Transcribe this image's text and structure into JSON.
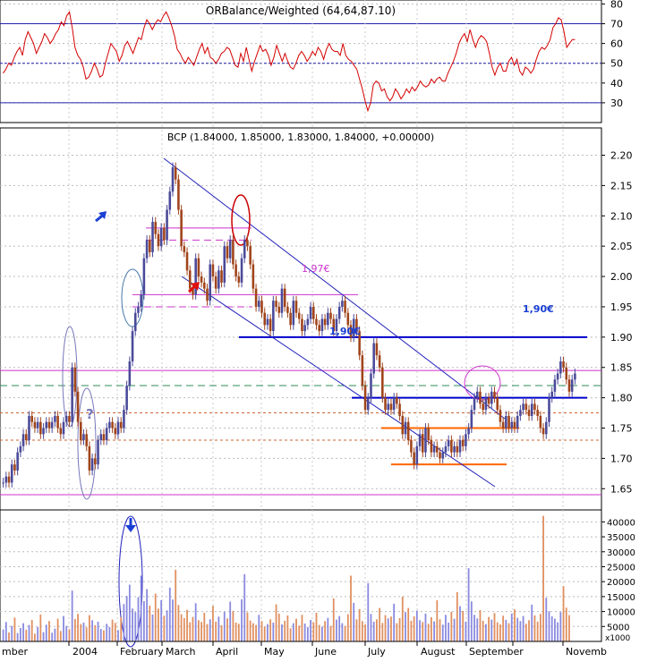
{
  "chart_data": {
    "type": "candlestick",
    "panels": [
      {
        "id": "rsi",
        "title": "ORBalance/Weighted (64,64,87.10)",
        "ylim": [
          20,
          82
        ],
        "tick_labels": [
          "80",
          "70",
          "60",
          "50",
          "40",
          "30"
        ],
        "reference_lines": [
          70,
          50,
          30
        ],
        "series_color": "#d40000",
        "values": [
          45,
          47,
          50,
          49,
          53,
          56,
          58,
          54,
          62,
          66,
          63,
          60,
          55,
          58,
          61,
          65,
          63,
          60,
          62,
          65,
          67,
          71,
          69,
          74,
          76,
          68,
          58,
          54,
          52,
          48,
          42,
          43,
          46,
          50,
          47,
          43,
          44,
          50,
          55,
          60,
          58,
          56,
          51,
          54,
          59,
          61,
          58,
          55,
          59,
          63,
          62,
          68,
          72,
          70,
          67,
          70,
          72,
          71,
          74,
          76,
          73,
          69,
          64,
          57,
          55,
          52,
          50,
          53,
          51,
          49,
          53,
          57,
          60,
          55,
          58,
          53,
          52,
          50,
          52,
          55,
          56,
          58,
          57,
          53,
          49,
          48,
          55,
          51,
          58,
          52,
          46,
          51,
          55,
          59,
          56,
          57,
          54,
          49,
          53,
          59,
          55,
          51,
          55,
          51,
          48,
          47,
          50,
          54,
          56,
          54,
          51,
          53,
          56,
          54,
          58,
          56,
          52,
          57,
          60,
          57,
          56,
          56,
          54,
          60,
          54,
          52,
          51,
          49,
          47,
          42,
          37,
          31,
          26,
          30,
          39,
          41,
          40,
          36,
          37,
          33,
          31,
          33,
          37,
          35,
          32,
          34,
          37,
          35,
          38,
          36,
          38,
          41,
          39,
          38,
          39,
          42,
          40,
          42,
          43,
          41,
          41,
          45,
          48,
          51,
          55,
          60,
          63,
          65,
          61,
          67,
          62,
          58,
          62,
          64,
          63,
          61,
          55,
          48,
          44,
          48,
          50,
          46,
          46,
          51,
          53,
          49,
          52,
          46,
          44,
          48,
          47,
          45,
          47,
          52,
          56,
          58,
          57,
          59,
          62,
          68,
          70,
          73,
          72,
          66,
          58,
          60,
          62,
          62
        ]
      },
      {
        "id": "price",
        "title": "BCP (1.84000, 1.85000, 1.83000, 1.84000, +0.00000)",
        "ylim": [
          1.615,
          2.245
        ],
        "tick_labels": [
          "2.20",
          "2.15",
          "2.10",
          "2.05",
          "2.00",
          "1.95",
          "1.90",
          "1.85",
          "1.80",
          "1.75",
          "1.70",
          "1.65"
        ],
        "closes": [
          1.66,
          1.67,
          1.66,
          1.69,
          1.68,
          1.71,
          1.72,
          1.74,
          1.73,
          1.77,
          1.76,
          1.75,
          1.76,
          1.74,
          1.75,
          1.76,
          1.75,
          1.76,
          1.77,
          1.75,
          1.74,
          1.76,
          1.77,
          1.76,
          1.85,
          1.81,
          1.76,
          1.73,
          1.74,
          1.72,
          1.68,
          1.7,
          1.69,
          1.73,
          1.74,
          1.73,
          1.75,
          1.76,
          1.75,
          1.74,
          1.76,
          1.75,
          1.78,
          1.82,
          1.86,
          1.91,
          1.94,
          1.95,
          1.97,
          2.03,
          2.06,
          2.04,
          2.09,
          2.07,
          2.05,
          2.08,
          2.06,
          2.11,
          2.14,
          2.18,
          2.16,
          2.11,
          2.05,
          2.04,
          2.01,
          1.98,
          1.97,
          2.03,
          2.0,
          1.99,
          1.98,
          1.96,
          2.02,
          2.0,
          1.98,
          2.01,
          1.99,
          2.05,
          2.03,
          2.06,
          2.02,
          2.0,
          1.99,
          2.03,
          2.06,
          2.05,
          2.02,
          1.98,
          1.95,
          1.96,
          1.94,
          1.92,
          1.93,
          1.91,
          1.96,
          1.95,
          1.94,
          1.98,
          1.95,
          1.94,
          1.92,
          1.96,
          1.94,
          1.93,
          1.91,
          1.92,
          1.93,
          1.95,
          1.93,
          1.92,
          1.91,
          1.93,
          1.92,
          1.94,
          1.93,
          1.91,
          1.93,
          1.95,
          1.96,
          1.94,
          1.92,
          1.9,
          1.93,
          1.91,
          1.87,
          1.82,
          1.78,
          1.8,
          1.84,
          1.89,
          1.87,
          1.85,
          1.8,
          1.78,
          1.79,
          1.78,
          1.8,
          1.79,
          1.77,
          1.74,
          1.76,
          1.73,
          1.71,
          1.69,
          1.72,
          1.74,
          1.71,
          1.75,
          1.73,
          1.71,
          1.72,
          1.71,
          1.7,
          1.71,
          1.72,
          1.73,
          1.71,
          1.72,
          1.71,
          1.73,
          1.72,
          1.74,
          1.75,
          1.78,
          1.8,
          1.81,
          1.79,
          1.78,
          1.8,
          1.79,
          1.81,
          1.8,
          1.78,
          1.76,
          1.75,
          1.77,
          1.75,
          1.76,
          1.75,
          1.77,
          1.78,
          1.79,
          1.78,
          1.77,
          1.79,
          1.78,
          1.77,
          1.75,
          1.74,
          1.76,
          1.8,
          1.81,
          1.83,
          1.84,
          1.86,
          1.85,
          1.83,
          1.81,
          1.83,
          1.84
        ],
        "horizontal_lines": [
          {
            "value": 2.08,
            "color": "#cc33cc",
            "style": "solid",
            "span": "mid-february to april"
          },
          {
            "value": 2.06,
            "color": "#cc33cc",
            "style": "dashed",
            "span": "mid-february to april"
          },
          {
            "value": 1.97,
            "color": "#cc33cc",
            "style": "solid",
            "span": "february to july"
          },
          {
            "value": 1.95,
            "color": "#cc33cc",
            "style": "dashed",
            "span": "february to april"
          },
          {
            "value": 1.9,
            "color": "#0000cc",
            "style": "solid",
            "span": "april to end"
          },
          {
            "value": 1.845,
            "color": "#cc33cc",
            "style": "solid",
            "span": "full width"
          },
          {
            "value": 1.82,
            "color": "#2e8b57",
            "style": "dashed",
            "span": "full width"
          },
          {
            "value": 1.8,
            "color": "#0000cc",
            "style": "solid",
            "span": "july to end"
          },
          {
            "value": 1.775,
            "color": "#cc6633",
            "style": "dotted",
            "span": "full width"
          },
          {
            "value": 1.75,
            "color": "#ff6600",
            "style": "solid",
            "span": "july to october"
          },
          {
            "value": 1.73,
            "color": "#cc6633",
            "style": "dotted",
            "span": "full width"
          },
          {
            "value": 1.69,
            "color": "#ff6600",
            "style": "solid",
            "span": "july to september"
          },
          {
            "value": 1.64,
            "color": "#cc33cc",
            "style": "solid",
            "span": "full width"
          }
        ],
        "annotations": [
          "1,97€",
          "1,90€",
          "1,90€",
          "?"
        ]
      },
      {
        "id": "volume",
        "title": "",
        "ylim": [
          0,
          44000
        ],
        "tick_labels": [
          "40000",
          "35000",
          "30000",
          "25000",
          "20000",
          "15000",
          "10000",
          "5000"
        ],
        "axis_multiplier": "x1000",
        "up_color": "#8a8ae0",
        "down_color": "#e09060",
        "values": [
          4000,
          6500,
          3000,
          5200,
          8000,
          2800,
          4500,
          6100,
          3900,
          5500,
          7200,
          2600,
          4800,
          9000,
          3100,
          5600,
          6800,
          2900,
          4300,
          7600,
          3500,
          8500,
          5200,
          4100,
          17000,
          7500,
          9200,
          5800,
          6300,
          4700,
          8800,
          7100,
          5400,
          6600,
          4200,
          3700,
          5900,
          4800,
          7300,
          6200,
          3800,
          8100,
          12500,
          15200,
          19000,
          11000,
          9800,
          14800,
          22000,
          13500,
          17500,
          12000,
          9000,
          16000,
          11000,
          13800,
          8600,
          10400,
          18000,
          14000,
          24000,
          12200,
          9100,
          7800,
          10600,
          6400,
          8200,
          12800,
          7100,
          6500,
          9600,
          5800,
          7400,
          11900,
          6600,
          8300,
          5400,
          9900,
          7700,
          13300,
          10200,
          6300,
          5900,
          14100,
          22500,
          9700,
          7000,
          6100,
          5500,
          8900,
          6800,
          4900,
          5800,
          7400,
          6300,
          12400,
          9300,
          5700,
          6900,
          8700,
          4400,
          6100,
          7600,
          5300,
          8900,
          6000,
          4800,
          7200,
          6400,
          9600,
          5500,
          4900,
          6800,
          7900,
          5200,
          14400,
          7300,
          8500,
          6100,
          5200,
          9100,
          22000,
          12900,
          7400,
          10800,
          6800,
          5700,
          19500,
          9200,
          6600,
          7400,
          11200,
          6200,
          8800,
          7700,
          8300,
          12600,
          6100,
          7800,
          15000,
          9800,
          11200,
          6900,
          8400,
          10300,
          7100,
          6500,
          9300,
          5900,
          8100,
          6700,
          13800,
          7400,
          5600,
          8900,
          6300,
          9900,
          7600,
          16500,
          11800,
          10200,
          6600,
          24500,
          13400,
          8900,
          7700,
          10500,
          6900,
          5800,
          8200,
          7300,
          9500,
          6400,
          5700,
          8600,
          7200,
          6100,
          9300,
          10700,
          7900,
          6800,
          8500,
          5900,
          7100,
          12300,
          8700,
          6600,
          9200,
          42000,
          14600,
          10100,
          8400,
          7600,
          6400,
          9800,
          18500,
          11300,
          8800
        ]
      }
    ],
    "x_tick_labels": [
      "mber",
      "2004",
      "February",
      "March",
      "April",
      "May",
      "June",
      "July",
      "August",
      "September",
      "Novemb"
    ],
    "legend": "none",
    "grid": true
  }
}
